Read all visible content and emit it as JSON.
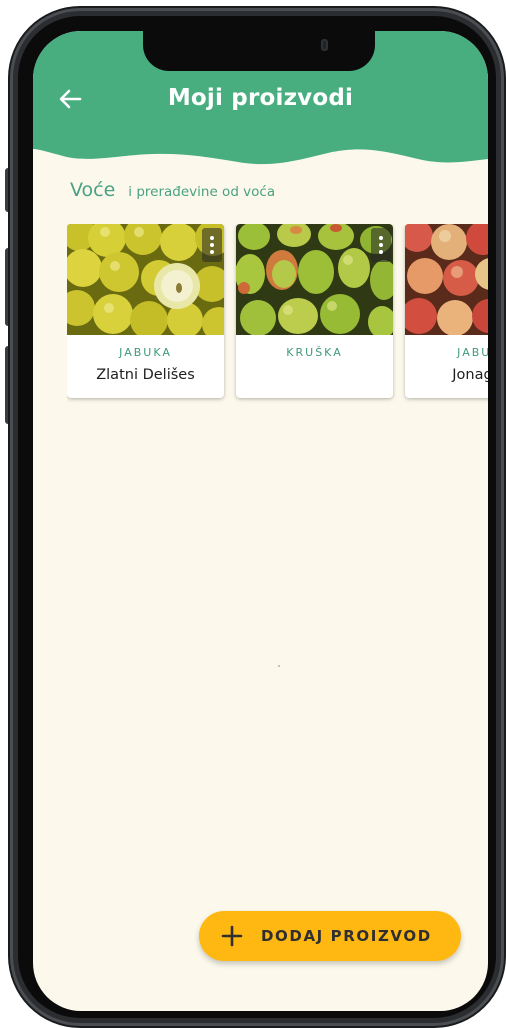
{
  "header": {
    "title": "Moji proizvodi",
    "back_icon": "arrow-left-icon",
    "background_color": "#48ae80"
  },
  "category": {
    "name": "Voće",
    "subtitle": "i prerađevine od voća"
  },
  "products": [
    {
      "type": "JABUKA",
      "name": "Zlatni Delišes",
      "image": "yellow-apples",
      "menu_icon": "more-vertical-icon"
    },
    {
      "type": "KRUŠKA",
      "name": "",
      "image": "green-pears",
      "menu_icon": "more-vertical-icon"
    },
    {
      "type": "JABUKA",
      "name": "Jonagold",
      "image": "red-apples"
    }
  ],
  "fab": {
    "label": "DODAJ PROIZVOD",
    "icon": "plus-icon",
    "color": "#ffb812"
  },
  "colors": {
    "screen_background": "#fcf9ec",
    "accent_text": "#4aa184"
  }
}
